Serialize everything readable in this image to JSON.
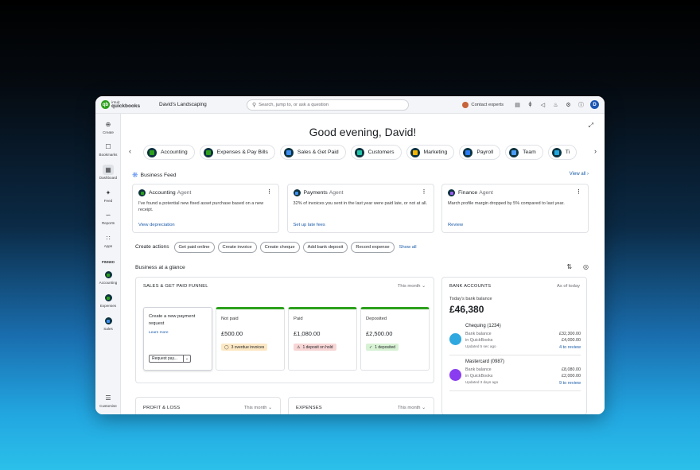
{
  "topbar": {
    "logo_line1": "intuit",
    "logo_line2": "quickbooks",
    "company": "David's Landscaping",
    "search_placeholder": "Search, jump to, or ask a question",
    "contact_label": "Contact experts",
    "user_initial": "D"
  },
  "sidebar": {
    "items": [
      {
        "label": "Create",
        "icon": "plus-circle-icon"
      },
      {
        "label": "Bookmarks",
        "icon": "bookmark-icon"
      },
      {
        "label": "Dashboard",
        "icon": "dashboard-icon"
      },
      {
        "label": "Feed",
        "icon": "sparkle-icon"
      },
      {
        "label": "Reports",
        "icon": "chart-icon"
      },
      {
        "label": "Apps",
        "icon": "grid-icon"
      }
    ],
    "pinned_label": "PINNED",
    "pinned": [
      {
        "label": "Accounting",
        "color": "#2ca01c"
      },
      {
        "label": "Expenses",
        "color": "#2ca01c"
      },
      {
        "label": "Sales",
        "color": "#3d8ef0"
      }
    ],
    "customise_label": "Customise"
  },
  "greeting": "Good evening, David!",
  "chips": [
    {
      "label": "Accounting",
      "color": "#2ca01c"
    },
    {
      "label": "Expenses & Pay Bills",
      "color": "#2ca01c"
    },
    {
      "label": "Sales & Get Paid",
      "color": "#3d8ef0"
    },
    {
      "label": "Customers",
      "color": "#21c4a8"
    },
    {
      "label": "Marketing",
      "color": "#f4b400"
    },
    {
      "label": "Payroll",
      "color": "#2b7bf5"
    },
    {
      "label": "Team",
      "color": "#4a9cf5"
    },
    {
      "label": "Ti",
      "color": "#21a8e0"
    }
  ],
  "feed": {
    "title": "Business Feed",
    "view_all": "View all",
    "cards": [
      {
        "name": "Accounting",
        "agent": "Agent",
        "color": "#2ca01c",
        "body": "I've found a potential new fixed asset purchase based on a new receipt.",
        "link": "View depreciation"
      },
      {
        "name": "Payments",
        "agent": "Agent",
        "color": "#3d8ef0",
        "body": "32% of invoices you sent in the last year were paid late, or not at all.",
        "link": "Set up late fees"
      },
      {
        "name": "Finance",
        "agent": "Agent",
        "color": "#9a5cf0",
        "body": "March profile margin dropped by 5% compared to last year.",
        "link": "Review"
      }
    ]
  },
  "create_actions": {
    "label": "Create actions",
    "items": [
      "Get paid online",
      "Create invoice",
      "Create cheque",
      "Add bank deposit",
      "Record expense"
    ],
    "show_all": "Show all"
  },
  "glance": {
    "title": "Business at a glance"
  },
  "funnel": {
    "title": "SALES & GET PAID FUNNEL",
    "period": "This month",
    "create_title": "Create a new payment request",
    "learn_more": "Learn more",
    "select_value": "Request pay...",
    "columns": [
      {
        "label": "Not paid",
        "amount": "£500.00",
        "badge": "3 overdue invoices",
        "status": "warn"
      },
      {
        "label": "Paid",
        "amount": "£1,080.00",
        "badge": "1 deposit on hold",
        "status": "err"
      },
      {
        "label": "Deposited",
        "amount": "£2,500.00",
        "badge": "1 deposited",
        "status": "ok"
      }
    ]
  },
  "bank": {
    "title": "BANK ACCOUNTS",
    "as_of": "As of today",
    "today_label": "Today's bank balance",
    "total": "£46,380",
    "accounts": [
      {
        "name": "Chequing (1234)",
        "bank_label": "Bank balance",
        "qb_label": "in QuickBooks",
        "bank_value": "£32,300.00",
        "qb_value": "£4,000.00",
        "updated": "Updated 5 sec ago",
        "review": "4 to review",
        "color": "#2fa8e0"
      },
      {
        "name": "Mastercard (0987)",
        "bank_label": "Bank balance",
        "qb_label": "in QuickBooks",
        "bank_value": "£8,080.00",
        "qb_value": "£2,000.00",
        "updated": "Updated 3 days ago",
        "review": "9 to review",
        "color": "#8a3df0"
      }
    ]
  },
  "profit_loss": {
    "title": "PROFIT & LOSS",
    "period": "This month"
  },
  "expenses": {
    "title": "EXPENSES",
    "period": "This month"
  }
}
